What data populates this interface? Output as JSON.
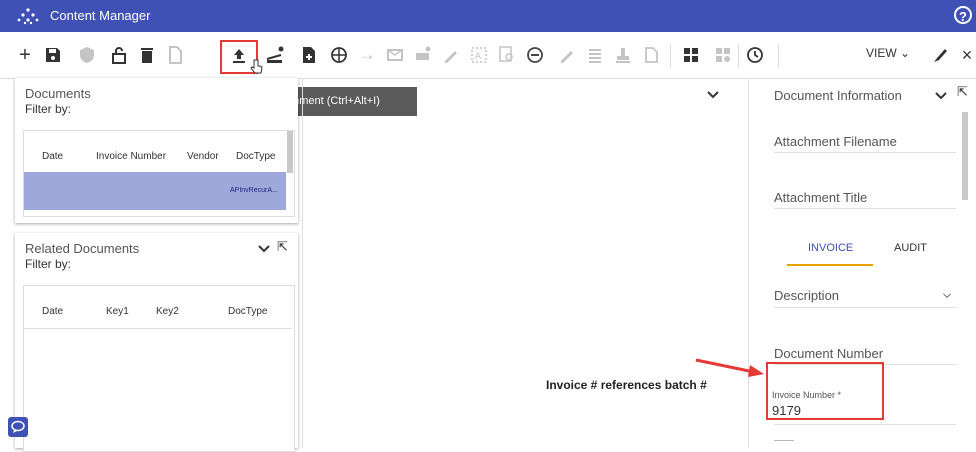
{
  "app": {
    "title": "Content Manager",
    "help_icon": "help-circle-icon"
  },
  "toolbar": {
    "view_label": "VIEW",
    "tooltip": "Import attachment (Ctrl+Alt+I)",
    "icons": [
      "add-icon",
      "save-icon",
      "shield-icon",
      "unlock-icon",
      "delete-icon",
      "document-icon",
      "import-attachment-icon",
      "scan-settings-icon",
      "file-plus-icon",
      "globe-icon",
      "forward-icon",
      "mail-icon",
      "print-settings-icon",
      "edit-icon",
      "text-scan-icon",
      "search-document-icon",
      "minus-circle-icon",
      "pencil-icon",
      "list-icon",
      "stamp-icon",
      "copy-icon",
      "grid-icon",
      "grid-settings-icon",
      "history-icon",
      "pen-icon",
      "close-icon"
    ]
  },
  "documents_panel": {
    "title": "Documents",
    "filter_label": "Filter by:",
    "columns": [
      "Date",
      "Invoice Number",
      "Vendor",
      "DocType"
    ],
    "rows": [
      {
        "date": "",
        "invoice_number": "",
        "vendor": "",
        "doctype": "APInvRecurA..."
      }
    ]
  },
  "related_panel": {
    "title": "Related Documents",
    "filter_label": "Filter by:",
    "columns": [
      "Date",
      "Key1",
      "Key2",
      "DocType"
    ]
  },
  "doc_info": {
    "title": "Document Information",
    "fields": {
      "attachment_filename": "Attachment Filename",
      "attachment_title": "Attachment Title",
      "description": "Description",
      "document_number": "Document Number",
      "invoice_number_label": "Invoice Number *",
      "invoice_number_value": "9179"
    },
    "tabs": [
      "INVOICE",
      "AUDIT"
    ],
    "active_tab": "INVOICE"
  },
  "annotation": {
    "text": "Invoice # references batch #"
  },
  "colors": {
    "header": "#3f51b5",
    "accent": "#e8a200",
    "highlight": "#e53935",
    "selected_row": "#9fa8da"
  }
}
